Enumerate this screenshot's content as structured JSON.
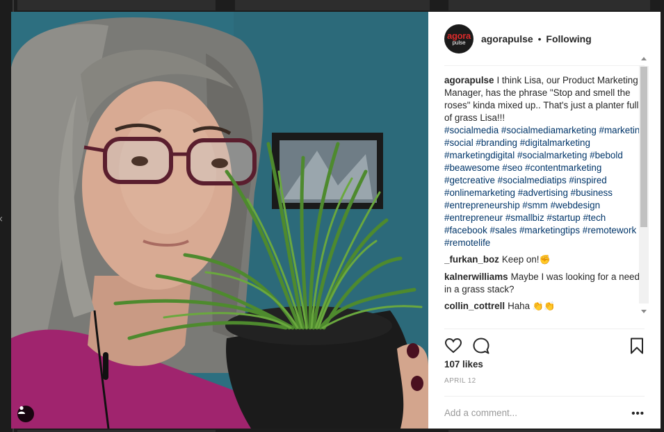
{
  "post": {
    "account": {
      "username": "agorapulse",
      "separator": "•",
      "follow_status": "Following",
      "avatar_line1": "agora",
      "avatar_line2": "pulse"
    },
    "caption": {
      "username": "agorapulse",
      "text": "I think Lisa, our Product Marketing Manager, has the phrase \"Stop and smell the roses\" kinda mixed up.. That's just a planter full of grass Lisa!!!",
      "hashtags": "#socialmedia #socialmediamarketing #marketing #social #branding #digitalmarketing #marketingdigital #socialmarketing #bebold #beawesome #seo #contentmarketing #getcreative #socialmediatips #inspired #onlinemarketing #advertising #business #entrepreneurship #smm #webdesign #entrepreneur #smallbiz #startup #tech #facebook #sales #marketingtips #remotework #remotelife"
    },
    "comments": [
      {
        "username": "_furkan_boz",
        "text": "Keep on!",
        "emoji": "✊"
      },
      {
        "username": "kalnerwilliams",
        "text": "Maybe I was looking for a needle in a grass stack?",
        "emoji": ""
      },
      {
        "username": "collin_cottrell",
        "text": "Haha",
        "emoji": "👏👏"
      }
    ],
    "likes": "107 likes",
    "date": "APRIL 12",
    "comment_placeholder": "Add a comment...",
    "more_label": "•••"
  },
  "icons": {
    "like": "heart-icon",
    "comment": "speech-bubble-icon",
    "save": "bookmark-icon",
    "tag": "person-icon",
    "more": "ellipsis-icon"
  },
  "colors": {
    "hashtag": "#003569",
    "text": "#262626",
    "muted": "#999999",
    "wall": "#2d6f80",
    "shirt": "#a0246e"
  }
}
